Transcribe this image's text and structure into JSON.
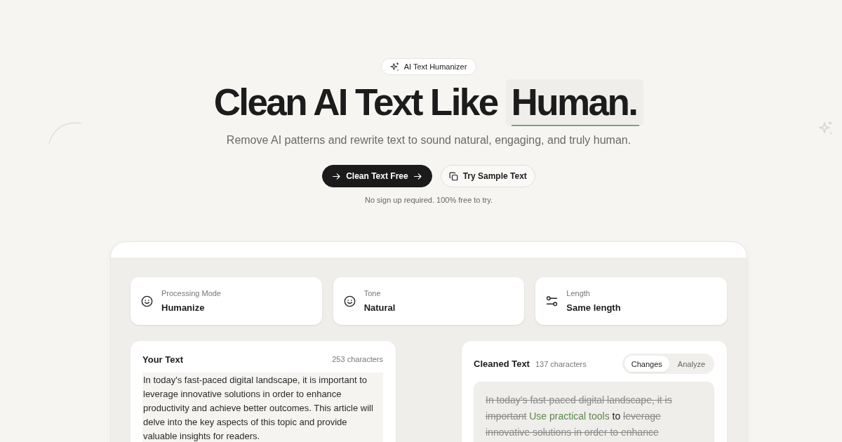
{
  "badge": {
    "label": "AI Text Humanizer"
  },
  "heading": {
    "text": "Clean AI Text Like",
    "highlight": "Human."
  },
  "subtitle": "Remove AI patterns and rewrite text to sound natural, engaging, and truly human.",
  "buttons": [
    {
      "kind": "primary",
      "label": "Clean Text Free"
    },
    {
      "kind": "secondary",
      "label": "Try Sample Text"
    }
  ],
  "note": "No sign up required. 100% free to try.",
  "settings": [
    {
      "kind": "mode",
      "label": "Processing Mode",
      "value": "Humanize"
    },
    {
      "kind": "tone",
      "label": "Tone",
      "value": "Natural"
    },
    {
      "kind": "length",
      "label": "Length",
      "value": "Same length"
    }
  ],
  "input_panel": {
    "title": "Your Text",
    "count": "253 characters",
    "value": "In today's fast-paced digital landscape, it is important to leverage innovative solutions in order to enhance productivity and achieve better outcomes. This article will delve into the key aspects of this topic and provide valuable insights for readers."
  },
  "output_panel": {
    "title": "Cleaned Text",
    "count": "137 characters",
    "tabs": [
      {
        "label": "Changes",
        "selected": true
      },
      {
        "label": "Analyze",
        "selected": false
      }
    ],
    "segments": [
      {
        "kind": "deleted",
        "text": "In today's fast-paced digital landscape, it is important"
      },
      {
        "kind": "inserted",
        "text": "Use practical tools"
      },
      {
        "kind": "unchanged",
        "text": "to"
      },
      {
        "kind": "deleted",
        "text": "leverage innovative solutions in order to enhance"
      }
    ]
  }
}
